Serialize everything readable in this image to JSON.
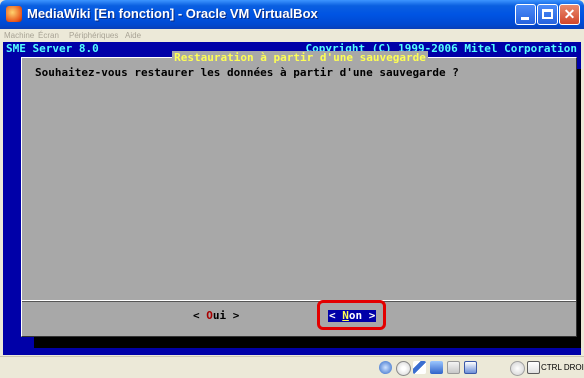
{
  "window": {
    "title": "MediaWiki [En fonction] - Oracle VM VirtualBox",
    "controls": {
      "minimize": "",
      "maximize": "",
      "close": "✕"
    }
  },
  "menubar": {
    "items": [
      "Machine",
      "Écran",
      "Périphériques",
      "Aide"
    ]
  },
  "console": {
    "header_left": "SME Server 8.0",
    "header_right": "Copyright (C) 1999-2006 Mitel Corporation",
    "dialog": {
      "title": "Restauration à partir d'une sauvegarde",
      "question": "Souhaitez-vous restaurer les données à partir d'une sauvegarde ?",
      "buttons": {
        "oui": {
          "open": "< ",
          "hotkey": "O",
          "rest": "ui",
          "close": " >"
        },
        "non": {
          "open": "< ",
          "hotkey": "N",
          "rest": "on",
          "close": " >",
          "selected": true
        }
      }
    },
    "colors": {
      "background": "#0000a8",
      "dialog": "#a8a8a8",
      "header": "#54fefe",
      "title": "#fefe54",
      "highlight": "#e30000"
    }
  },
  "statusbar": {
    "icons": [
      "hard-disk-icon",
      "optical-drive-icon",
      "usb-icon",
      "network-icon",
      "shared-folder-icon",
      "display-icon",
      "capture-icon",
      "mouse-integration-icon"
    ],
    "host_key": "CTRL DROITE"
  }
}
